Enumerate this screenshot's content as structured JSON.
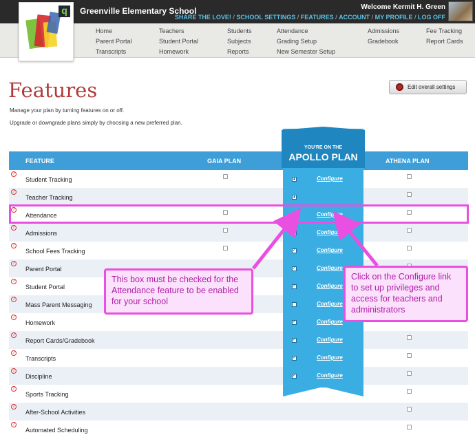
{
  "header": {
    "school_name": "Greenville Elementary School",
    "welcome": "Welcome Kermit H. Green",
    "account_links": [
      "SHARE THE LOVE!",
      "SCHOOL SETTINGS",
      "FEATURES",
      "ACCOUNT",
      "MY PROFILE",
      "LOG OFF"
    ]
  },
  "nav": {
    "home": "Home",
    "parent_portal": "Parent Portal",
    "transcripts": "Transcripts",
    "teachers": "Teachers",
    "student_portal": "Student Portal",
    "homework": "Homework",
    "students": "Students",
    "subjects": "Subjects",
    "reports": "Reports",
    "attendance": "Attendance",
    "grading_setup": "Grading Setup",
    "new_semester_setup": "New Semester Setup",
    "admissions": "Admissions",
    "gradebook": "Gradebook",
    "fee_tracking": "Fee Tracking",
    "report_cards": "Report Cards"
  },
  "page": {
    "title": "Features",
    "settings_button": "Edit overall settings",
    "desc1": "Manage your plan by turning features on or off.",
    "desc2": "Upgrade or downgrade plans simply by choosing a new preferred plan."
  },
  "table": {
    "col_feature": "FEATURE",
    "col_gaia": "GAIA PLAN",
    "apollo_small": "YOU'RE ON THE",
    "apollo_big": "APOLLO PLAN",
    "col_athena": "ATHENA PLAN",
    "configure": "Configure",
    "help_mark": "?",
    "rows": [
      {
        "name": "Student Tracking",
        "gaia": true,
        "apollo": "icon",
        "configure": true,
        "athena": true
      },
      {
        "name": "Teacher Tracking",
        "gaia": false,
        "apollo": "icon",
        "configure": false,
        "athena": true
      },
      {
        "name": "Attendance",
        "gaia": true,
        "apollo": "checked",
        "configure": true,
        "athena": true
      },
      {
        "name": "Admissions",
        "gaia": true,
        "apollo": "checked",
        "configure": true,
        "athena": true
      },
      {
        "name": "School Fees Tracking",
        "gaia": true,
        "apollo": "checked",
        "configure": true,
        "athena": true
      },
      {
        "name": "Parent Portal",
        "gaia": false,
        "apollo": "checked",
        "configure": true,
        "athena": true
      },
      {
        "name": "Student Portal",
        "gaia": false,
        "apollo": "checked",
        "configure": true,
        "athena": true
      },
      {
        "name": "Mass Parent Messaging",
        "gaia": false,
        "apollo": "unchecked",
        "configure": true,
        "athena": true
      },
      {
        "name": "Homework",
        "gaia": false,
        "apollo": "checked",
        "configure": true,
        "athena": true
      },
      {
        "name": "Report Cards/Gradebook",
        "gaia": false,
        "apollo": "checked",
        "configure": true,
        "athena": true
      },
      {
        "name": "Transcripts",
        "gaia": false,
        "apollo": "checked",
        "configure": true,
        "athena": true
      },
      {
        "name": "Discipline",
        "gaia": false,
        "apollo": "checked",
        "configure": true,
        "athena": true
      },
      {
        "name": "Sports Tracking",
        "gaia": false,
        "apollo": "none",
        "configure": false,
        "athena": true
      },
      {
        "name": "After-School Activities",
        "gaia": false,
        "apollo": "none",
        "configure": false,
        "athena": true
      },
      {
        "name": "Automated Scheduling",
        "gaia": false,
        "apollo": "none",
        "configure": false,
        "athena": true
      }
    ]
  },
  "annotations": {
    "left": "This box must be checked for the Attendance feature to be enabled for your school",
    "right": "Click on the Configure link to set up privileges and access for teachers and administrators",
    "color": "#e94fe0"
  }
}
